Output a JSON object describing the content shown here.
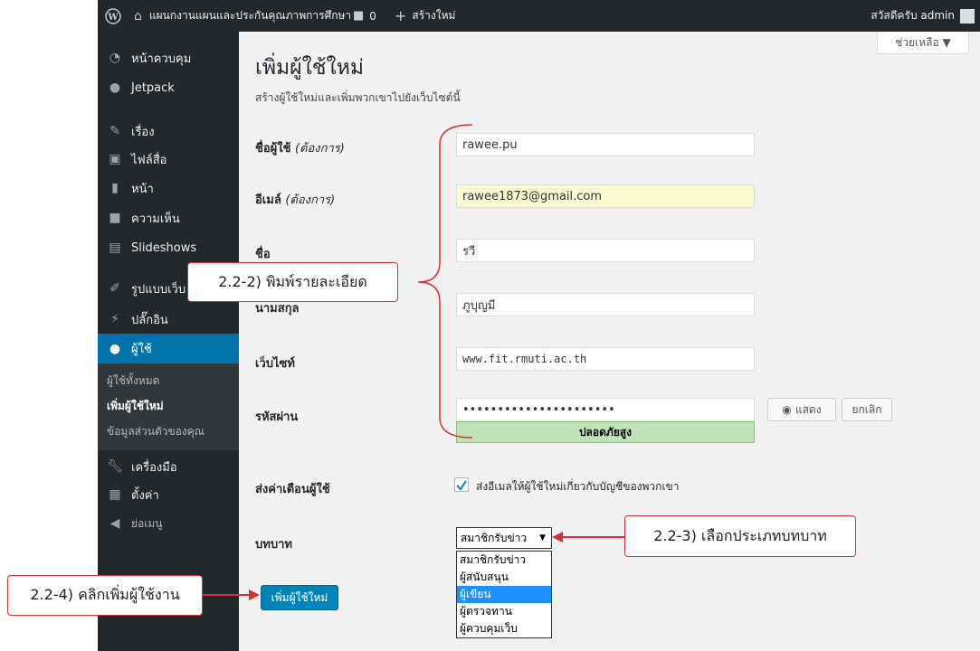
{
  "adminbar": {
    "site_name": "แผนกงานแผนและประกันคุณภาพการศึกษา",
    "comments_count": "0",
    "new_label": "สร้างใหม่",
    "greeting": "สวัสดีครับ admin"
  },
  "sidebar": {
    "items": [
      {
        "label": "หน้าควบคุม",
        "icon": "dashboard-icon"
      },
      {
        "label": "Jetpack",
        "icon": "jetpack-icon"
      },
      {
        "label": "เรื่อง",
        "icon": "pushpin-icon"
      },
      {
        "label": "ไฟล์สื่อ",
        "icon": "media-icon"
      },
      {
        "label": "หน้า",
        "icon": "page-icon"
      },
      {
        "label": "ความเห็น",
        "icon": "comment-icon"
      },
      {
        "label": "Slideshows",
        "icon": "slideshow-icon"
      },
      {
        "label": "รูปแบบเว็บ",
        "icon": "appearance-icon"
      },
      {
        "label": "ปลั๊กอิน",
        "icon": "plugin-icon"
      },
      {
        "label": "ผู้ใช้",
        "icon": "users-icon"
      },
      {
        "label": "เครื่องมือ",
        "icon": "tools-icon"
      },
      {
        "label": "ตั้งค่า",
        "icon": "settings-icon"
      },
      {
        "label": "ย่อเมนู",
        "icon": "collapse-icon"
      }
    ],
    "submenu": [
      "ผู้ใช้ทั้งหมด",
      "เพิ่มผู้ใช้ใหม่",
      "ข้อมูลส่วนตัวของคุณ"
    ]
  },
  "page": {
    "help_label": "ช่วยเหลือ ▼",
    "title": "เพิ่มผู้ใช้ใหม่",
    "description": "สร้างผู้ใช้ใหม่และเพิ่มพวกเขาไปยังเว็บไซต์นี้"
  },
  "form": {
    "username_label": "ชื่อผู้ใช้",
    "required": "(ต้องการ)",
    "username_value": "rawee.pu",
    "email_label": "อีเมล์",
    "email_value": "rawee1873@gmail.com",
    "firstname_label": "ชื่อ",
    "firstname_value": "รวี",
    "lastname_label": "นามสกุล",
    "lastname_value": "ภูบุญมี",
    "website_label": "เว็บไซท์",
    "website_value": "www.fit.rmuti.ac.th",
    "password_label": "รหัสผ่าน",
    "password_value": "••••••••••••••••••••••",
    "show_label": "แสดง",
    "cancel_label": "ยกเลิก",
    "strength_label": "ปลอดภัยสูง",
    "notify_label": "ส่งค่าเตือนผู้ใช้",
    "notify_checked": true,
    "notify_text": "ส่งอีเมลให้ผู้ใช้ใหม่เกี่ยวกับบัญชีของพวกเขา",
    "role_label": "บทบาท",
    "role_selected": "สมาชิกรับข่าว",
    "role_options": [
      "สมาชิกรับข่าว",
      "ผู้สนับสนุน",
      "ผู้เขียน",
      "ผู้ตรวจทาน",
      "ผู้ควบคุมเว็บ"
    ],
    "role_highlighted": "ผู้เขียน",
    "submit_label": "เพิ่มผู้ใช้ใหม่"
  },
  "annotations": {
    "step_details": "2.2-2) พิมพ์รายละเอียด",
    "step_role": "2.2-3) เลือกประเภทบทบาท",
    "step_submit": "2.2-4) คลิกเพิ่มผู้ใช้งาน",
    "color": "#d63034"
  },
  "colors": {
    "adminbar": "#23282d",
    "accent": "#0073aa",
    "primary_button": "#0085ba",
    "strength_bg": "#c1e1b9"
  }
}
